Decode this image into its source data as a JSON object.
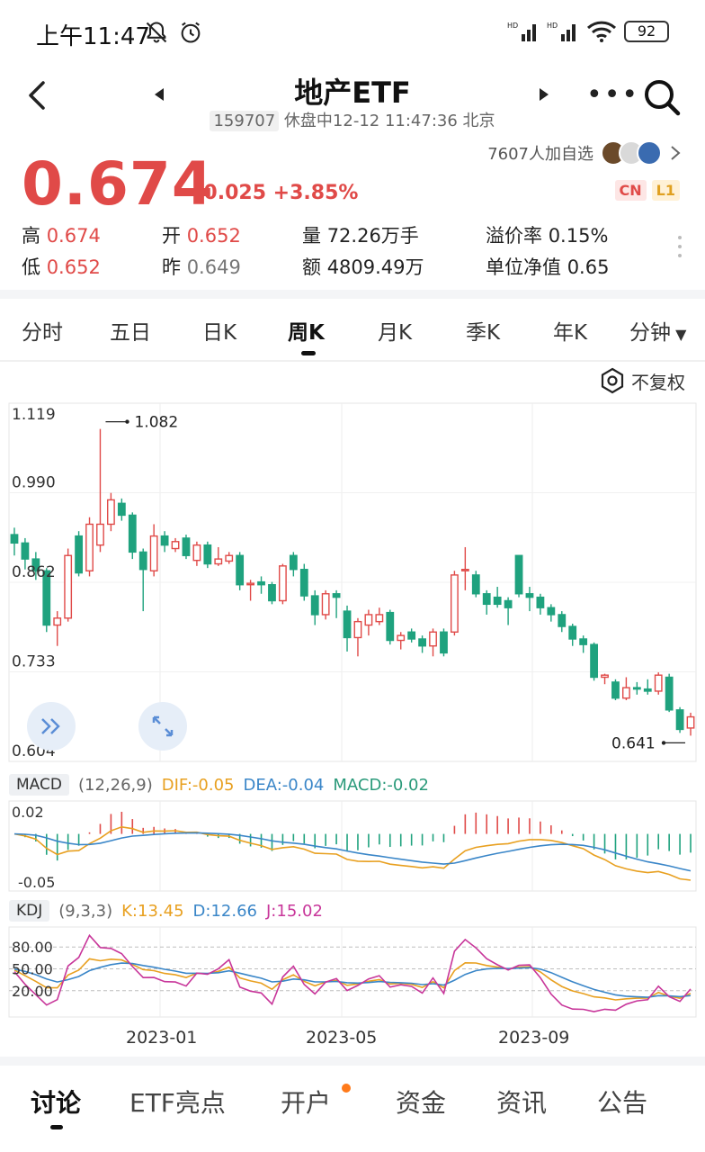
{
  "status": {
    "time": "上午11:47",
    "battery": "92"
  },
  "header": {
    "title": "地产ETF",
    "code": "159707",
    "status_text": "休盘中12-12 11:47:36 北京"
  },
  "quote": {
    "watch_count": "7607人加自选",
    "price": "0.674",
    "change": "+0.025 +3.85%",
    "badges": [
      "CN",
      "L1"
    ],
    "up_color": "#e04a48",
    "down_color": "#1fa27e",
    "stats": [
      {
        "label": "高",
        "value": "0.674"
      },
      {
        "label": "开",
        "value": "0.652"
      },
      {
        "label": "量",
        "value": "72.26万手"
      },
      {
        "label": "溢价率",
        "value": "0.15%"
      },
      {
        "label": "低",
        "value": "0.652"
      },
      {
        "label": "昨",
        "value": "0.649"
      },
      {
        "label": "额",
        "value": "4809.49万"
      },
      {
        "label": "单位净值",
        "value": "0.65"
      }
    ]
  },
  "period_tabs": [
    "分时",
    "五日",
    "日K",
    "周K",
    "月K",
    "季K",
    "年K",
    "分钟"
  ],
  "active_period": "周K",
  "fuquan_label": "不复权",
  "indicators": {
    "macd": {
      "name": "MACD",
      "params": "(12,26,9)",
      "dif": "DIF:-0.05",
      "dea": "DEA:-0.04",
      "macd": "MACD:-0.02"
    },
    "kdj": {
      "name": "KDJ",
      "params": "(9,3,3)",
      "k": "K:13.45",
      "d": "D:12.66",
      "j": "J:15.02"
    }
  },
  "bottom_tabs": [
    "讨论",
    "ETF亮点",
    "开户",
    "资金",
    "资讯",
    "公告"
  ],
  "active_bottom_tab": "讨论",
  "chart_data": {
    "type": "candlestick",
    "y_ticks": [
      "1.119",
      "0.990",
      "0.862",
      "0.733",
      "0.604"
    ],
    "ylim": [
      0.604,
      1.119
    ],
    "max_label": "1.082",
    "min_label": "0.641",
    "x_labels": [
      "2023-01",
      "2023-05",
      "2023-09"
    ],
    "candles": [
      {
        "o": 0.93,
        "c": 0.918,
        "h": 0.94,
        "l": 0.9
      },
      {
        "o": 0.918,
        "c": 0.895,
        "h": 0.925,
        "l": 0.88
      },
      {
        "o": 0.895,
        "c": 0.878,
        "h": 0.905,
        "l": 0.865
      },
      {
        "o": 0.878,
        "c": 0.8,
        "h": 0.882,
        "l": 0.79
      },
      {
        "o": 0.8,
        "c": 0.81,
        "h": 0.82,
        "l": 0.77
      },
      {
        "o": 0.81,
        "c": 0.9,
        "h": 0.91,
        "l": 0.805
      },
      {
        "o": 0.928,
        "c": 0.875,
        "h": 0.935,
        "l": 0.87
      },
      {
        "o": 0.878,
        "c": 0.945,
        "h": 0.955,
        "l": 0.87
      },
      {
        "o": 0.915,
        "c": 0.945,
        "h": 1.082,
        "l": 0.905
      },
      {
        "o": 0.945,
        "c": 0.98,
        "h": 0.99,
        "l": 0.935
      },
      {
        "o": 0.975,
        "c": 0.958,
        "h": 0.982,
        "l": 0.95
      },
      {
        "o": 0.958,
        "c": 0.905,
        "h": 0.962,
        "l": 0.895
      },
      {
        "o": 0.905,
        "c": 0.88,
        "h": 0.91,
        "l": 0.82
      },
      {
        "o": 0.878,
        "c": 0.928,
        "h": 0.945,
        "l": 0.87
      },
      {
        "o": 0.928,
        "c": 0.915,
        "h": 0.935,
        "l": 0.905
      },
      {
        "o": 0.91,
        "c": 0.92,
        "h": 0.925,
        "l": 0.905
      },
      {
        "o": 0.925,
        "c": 0.9,
        "h": 0.93,
        "l": 0.895
      },
      {
        "o": 0.893,
        "c": 0.915,
        "h": 0.92,
        "l": 0.885
      },
      {
        "o": 0.915,
        "c": 0.888,
        "h": 0.92,
        "l": 0.882
      },
      {
        "o": 0.888,
        "c": 0.895,
        "h": 0.912,
        "l": 0.885
      },
      {
        "o": 0.892,
        "c": 0.9,
        "h": 0.905,
        "l": 0.888
      },
      {
        "o": 0.9,
        "c": 0.858,
        "h": 0.905,
        "l": 0.85
      },
      {
        "o": 0.858,
        "c": 0.86,
        "h": 0.865,
        "l": 0.835
      },
      {
        "o": 0.862,
        "c": 0.858,
        "h": 0.87,
        "l": 0.845
      },
      {
        "o": 0.858,
        "c": 0.835,
        "h": 0.862,
        "l": 0.83
      },
      {
        "o": 0.835,
        "c": 0.885,
        "h": 0.888,
        "l": 0.83
      },
      {
        "o": 0.9,
        "c": 0.88,
        "h": 0.905,
        "l": 0.87
      },
      {
        "o": 0.88,
        "c": 0.842,
        "h": 0.888,
        "l": 0.835
      },
      {
        "o": 0.842,
        "c": 0.815,
        "h": 0.85,
        "l": 0.8
      },
      {
        "o": 0.815,
        "c": 0.845,
        "h": 0.85,
        "l": 0.808
      },
      {
        "o": 0.845,
        "c": 0.84,
        "h": 0.85,
        "l": 0.81
      },
      {
        "o": 0.82,
        "c": 0.782,
        "h": 0.828,
        "l": 0.762
      },
      {
        "o": 0.782,
        "c": 0.805,
        "h": 0.81,
        "l": 0.755
      },
      {
        "o": 0.8,
        "c": 0.815,
        "h": 0.822,
        "l": 0.785
      },
      {
        "o": 0.805,
        "c": 0.815,
        "h": 0.825,
        "l": 0.8
      },
      {
        "o": 0.818,
        "c": 0.778,
        "h": 0.822,
        "l": 0.772
      },
      {
        "o": 0.778,
        "c": 0.785,
        "h": 0.79,
        "l": 0.765
      },
      {
        "o": 0.79,
        "c": 0.78,
        "h": 0.795,
        "l": 0.775
      },
      {
        "o": 0.78,
        "c": 0.77,
        "h": 0.785,
        "l": 0.76
      },
      {
        "o": 0.77,
        "c": 0.79,
        "h": 0.795,
        "l": 0.755
      },
      {
        "o": 0.79,
        "c": 0.76,
        "h": 0.795,
        "l": 0.755
      },
      {
        "o": 0.79,
        "c": 0.872,
        "h": 0.878,
        "l": 0.785
      },
      {
        "o": 0.88,
        "c": 0.88,
        "h": 0.912,
        "l": 0.85
      },
      {
        "o": 0.872,
        "c": 0.845,
        "h": 0.878,
        "l": 0.84
      },
      {
        "o": 0.845,
        "c": 0.83,
        "h": 0.85,
        "l": 0.815
      },
      {
        "o": 0.84,
        "c": 0.83,
        "h": 0.855,
        "l": 0.825
      },
      {
        "o": 0.835,
        "c": 0.825,
        "h": 0.84,
        "l": 0.8
      },
      {
        "o": 0.9,
        "c": 0.845,
        "h": 0.9,
        "l": 0.84
      },
      {
        "o": 0.845,
        "c": 0.84,
        "h": 0.855,
        "l": 0.82
      },
      {
        "o": 0.84,
        "c": 0.825,
        "h": 0.845,
        "l": 0.815
      },
      {
        "o": 0.825,
        "c": 0.815,
        "h": 0.83,
        "l": 0.805
      },
      {
        "o": 0.815,
        "c": 0.798,
        "h": 0.82,
        "l": 0.79
      },
      {
        "o": 0.798,
        "c": 0.78,
        "h": 0.802,
        "l": 0.77
      },
      {
        "o": 0.78,
        "c": 0.772,
        "h": 0.785,
        "l": 0.76
      },
      {
        "o": 0.772,
        "c": 0.725,
        "h": 0.775,
        "l": 0.72
      },
      {
        "o": 0.725,
        "c": 0.728,
        "h": 0.73,
        "l": 0.715
      },
      {
        "o": 0.718,
        "c": 0.695,
        "h": 0.722,
        "l": 0.692
      },
      {
        "o": 0.695,
        "c": 0.71,
        "h": 0.725,
        "l": 0.692
      },
      {
        "o": 0.71,
        "c": 0.708,
        "h": 0.718,
        "l": 0.7
      },
      {
        "o": 0.708,
        "c": 0.705,
        "h": 0.722,
        "l": 0.7
      },
      {
        "o": 0.705,
        "c": 0.728,
        "h": 0.732,
        "l": 0.7
      },
      {
        "o": 0.725,
        "c": 0.678,
        "h": 0.73,
        "l": 0.675
      },
      {
        "o": 0.678,
        "c": 0.65,
        "h": 0.682,
        "l": 0.645
      },
      {
        "o": 0.652,
        "c": 0.668,
        "h": 0.674,
        "l": 0.641
      }
    ],
    "macd_ticks": [
      "0.02",
      "-0.05"
    ],
    "kdj_ticks": [
      "80.00",
      "50.00",
      "20.00"
    ]
  }
}
